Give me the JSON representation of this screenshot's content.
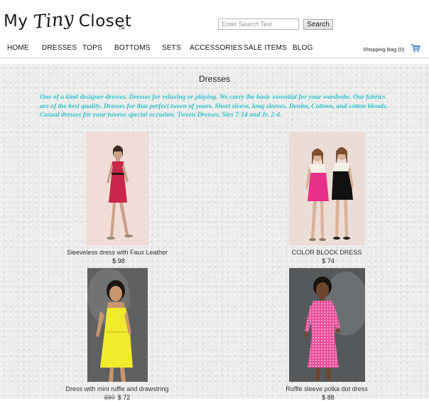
{
  "header": {
    "logo_text": "My Tiny Closet",
    "logo_parts": {
      "first": "My",
      "script": "Tiny",
      "last": "Closet"
    },
    "trademark": "TM"
  },
  "search": {
    "placeholder": "Enter Search Text",
    "button_label": "Search"
  },
  "nav": {
    "items": [
      {
        "label": "HOME"
      },
      {
        "label": "DRESSES"
      },
      {
        "label": "TOPS"
      },
      {
        "label": "BOTTOMS"
      },
      {
        "label": "SETS"
      },
      {
        "label": "ACCESSORIES"
      },
      {
        "label": "SALE ITEMS"
      },
      {
        "label": "BLOG"
      }
    ],
    "cart_label": "Shopping Bag (0)",
    "cart_icon": "shopping-cart-icon"
  },
  "page": {
    "title": "Dresses",
    "intro": "One of a kind designer dresses. Dresses for relaxing or playing. We carry the basic essential for your wardrobe. Our fabrics are of the best quality. Dresses for that perfect tween of yours. Short sleeve, long sleeves. Denim, Cottons, and cotton blends. Casual dresses  for your tweens special occasion. Tween Dresses, Sies 7-14 and Jr. 2-4.",
    "intro_color": "#2ec4c8"
  },
  "products": [
    {
      "name": "Sleeveless dress with Faux Leather",
      "price": "$ 98",
      "old_price": "",
      "dress_color": "#c8264a",
      "backdrop": "#f1ddd8"
    },
    {
      "name": "COLOR BLOCK DRESS",
      "price": "$ 74",
      "old_price": "",
      "dress_color": "#e8308a",
      "backdrop": "#ecdcd6"
    },
    {
      "name": "Dress with mini ruffle and drawstring",
      "price": "$ 72",
      "old_price": "$80",
      "dress_color": "#f2ea2c",
      "backdrop": "#5e6062"
    },
    {
      "name": "Ruffle sleeve polka dot dress",
      "price": "$ 88",
      "old_price": "",
      "dress_color": "#e8509a",
      "backdrop": "#56595c"
    }
  ]
}
